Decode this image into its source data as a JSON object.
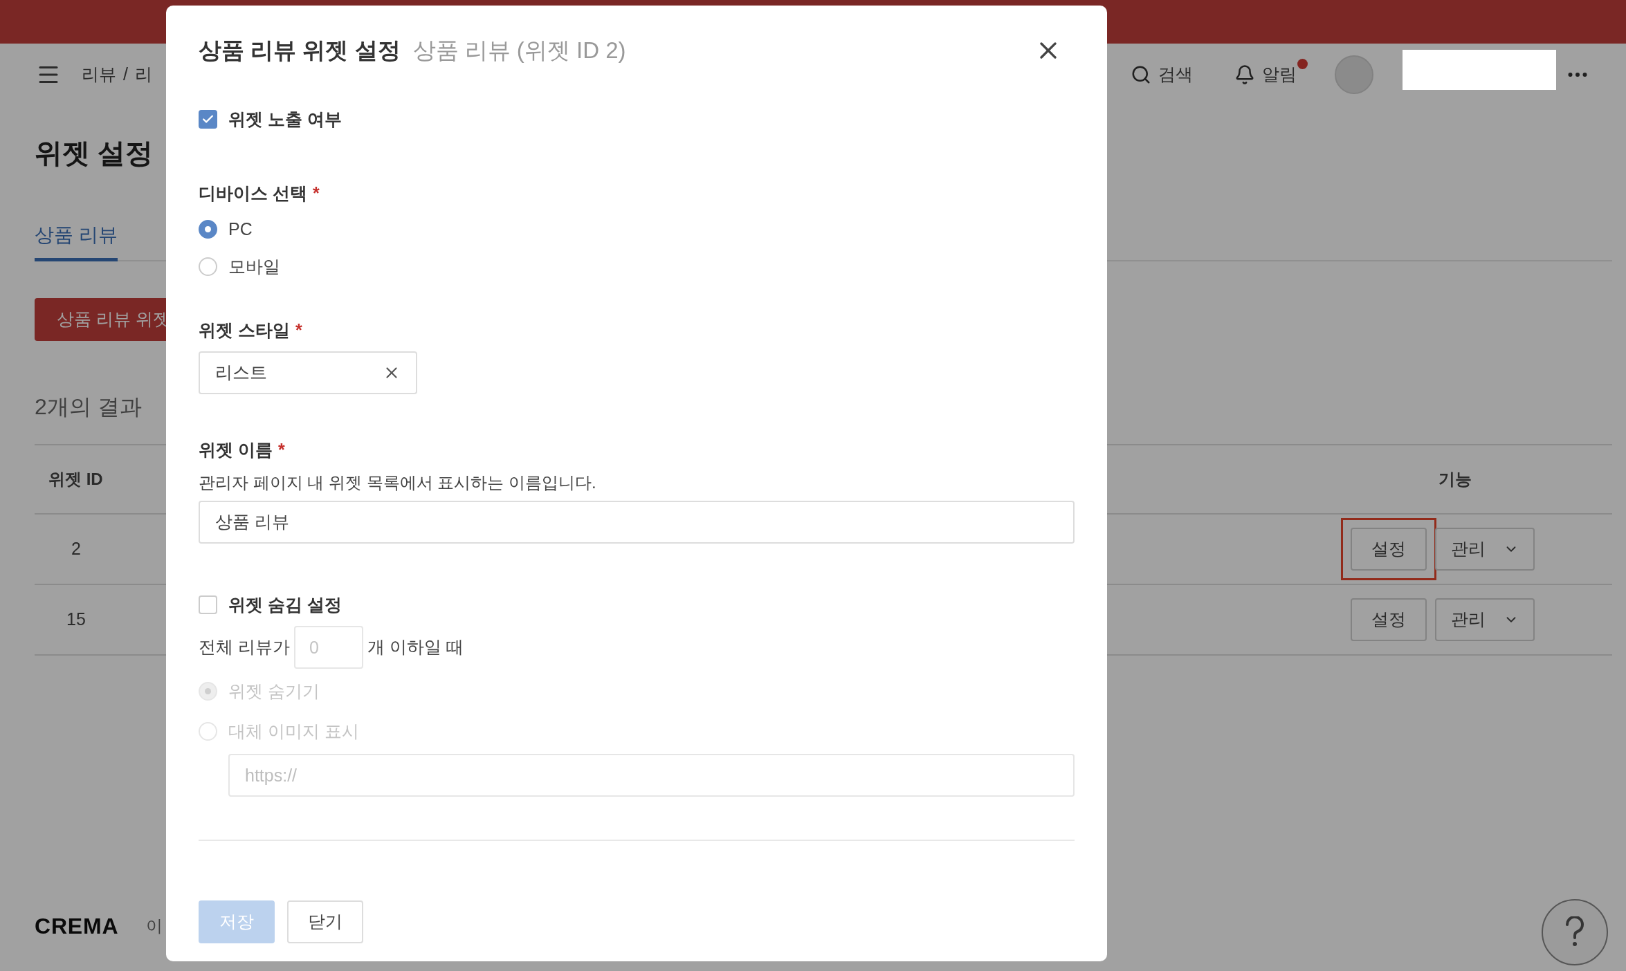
{
  "header": {
    "breadcrumb": [
      "리뷰",
      "/",
      "리"
    ],
    "search_label": "검색",
    "notifications_label": "알림",
    "has_unread": true
  },
  "page": {
    "title": "위젯 설정",
    "tabs": [
      {
        "label": "상품 리뷰",
        "selected": true
      }
    ],
    "create_button": "상품 리뷰 위젯",
    "result_count": "2개의 결과",
    "table": {
      "columns": [
        "위젯 ID",
        "기능"
      ],
      "rows": [
        {
          "id": "2",
          "actions": [
            "설정",
            "관리"
          ],
          "highlighted": true
        },
        {
          "id": "15",
          "actions": [
            "설정",
            "관리"
          ],
          "highlighted": false
        }
      ]
    },
    "footer": {
      "logo": "CREMA",
      "link": "이"
    }
  },
  "modal": {
    "title": "상품 리뷰 위젯 설정",
    "subtitle": "상품 리뷰 (위젯 ID 2)",
    "fields": [
      {
        "kind": "checkbox",
        "label": "위젯 노출 여부",
        "checked": true
      },
      {
        "kind": "radio_group",
        "label": "디바이스 선택",
        "required_mark": "*",
        "options": [
          {
            "label": "PC",
            "selected": true
          },
          {
            "label": "모바일",
            "selected": false
          }
        ]
      },
      {
        "kind": "select",
        "label": "위젯 스타일",
        "required_mark": "*",
        "value": "리스트"
      },
      {
        "kind": "text",
        "label": "위젯 이름",
        "required_mark": "*",
        "help": "관리자 페이지 내 위젯 목록에서 표시하는 이름입니다.",
        "value": "상품 리뷰"
      },
      {
        "kind": "hide_settings",
        "label": "위젯 숨김 설정",
        "checked": false,
        "prefix": "전체 리뷰가",
        "count_placeholder": "0",
        "suffix": "개 이하일 때",
        "options": [
          {
            "label": "위젯 숨기기",
            "selected": true,
            "disabled": true
          },
          {
            "label": "대체 이미지 표시",
            "selected": false,
            "disabled": true
          }
        ],
        "url_placeholder": "https://"
      }
    ],
    "buttons": [
      {
        "label": "저장",
        "kind": "primary",
        "disabled": true
      },
      {
        "label": "닫기",
        "kind": "secondary",
        "disabled": false
      }
    ]
  }
}
